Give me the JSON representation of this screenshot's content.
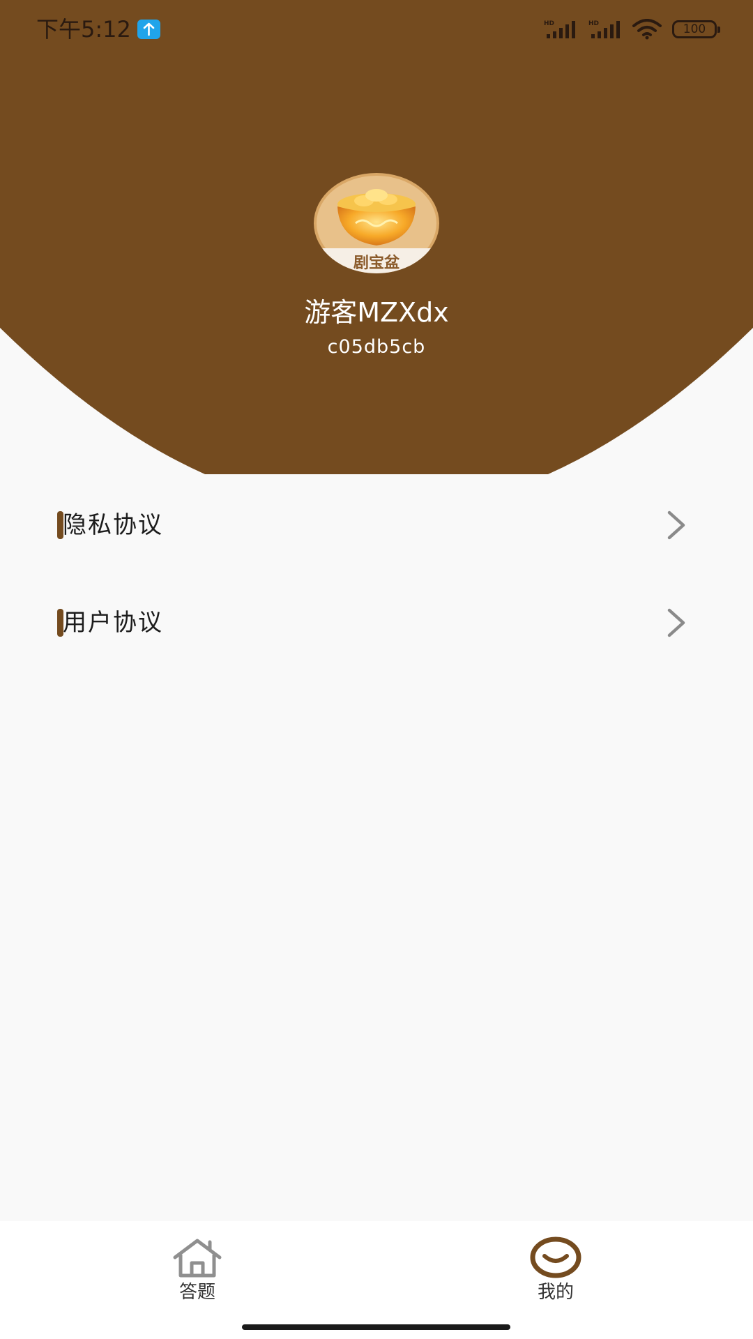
{
  "colors": {
    "header_brown": "#744b1f",
    "background": "#f9f9f9",
    "accent_bar": "#744b1f",
    "chevron_gray": "#8a8a8a",
    "tab_bar_bg": "#ffffff",
    "upload_blue": "#20a4ea"
  },
  "status_bar": {
    "time": "下午5:12",
    "icons": [
      "upload-icon",
      "hd-signal-icon",
      "hd-signal-icon",
      "wifi-icon",
      "battery-icon"
    ],
    "battery": "100"
  },
  "profile": {
    "avatar_text": "剧宝盆",
    "username": "游客MZXdx",
    "user_id": "c05db5cb"
  },
  "menu": [
    {
      "label": "隐私协议",
      "icon": "chevron-right-icon"
    },
    {
      "label": "用户协议",
      "icon": "chevron-right-icon"
    }
  ],
  "tabs": [
    {
      "label": "答题",
      "icon": "home-icon",
      "active": false
    },
    {
      "label": "我的",
      "icon": "smile-icon",
      "active": true
    }
  ]
}
